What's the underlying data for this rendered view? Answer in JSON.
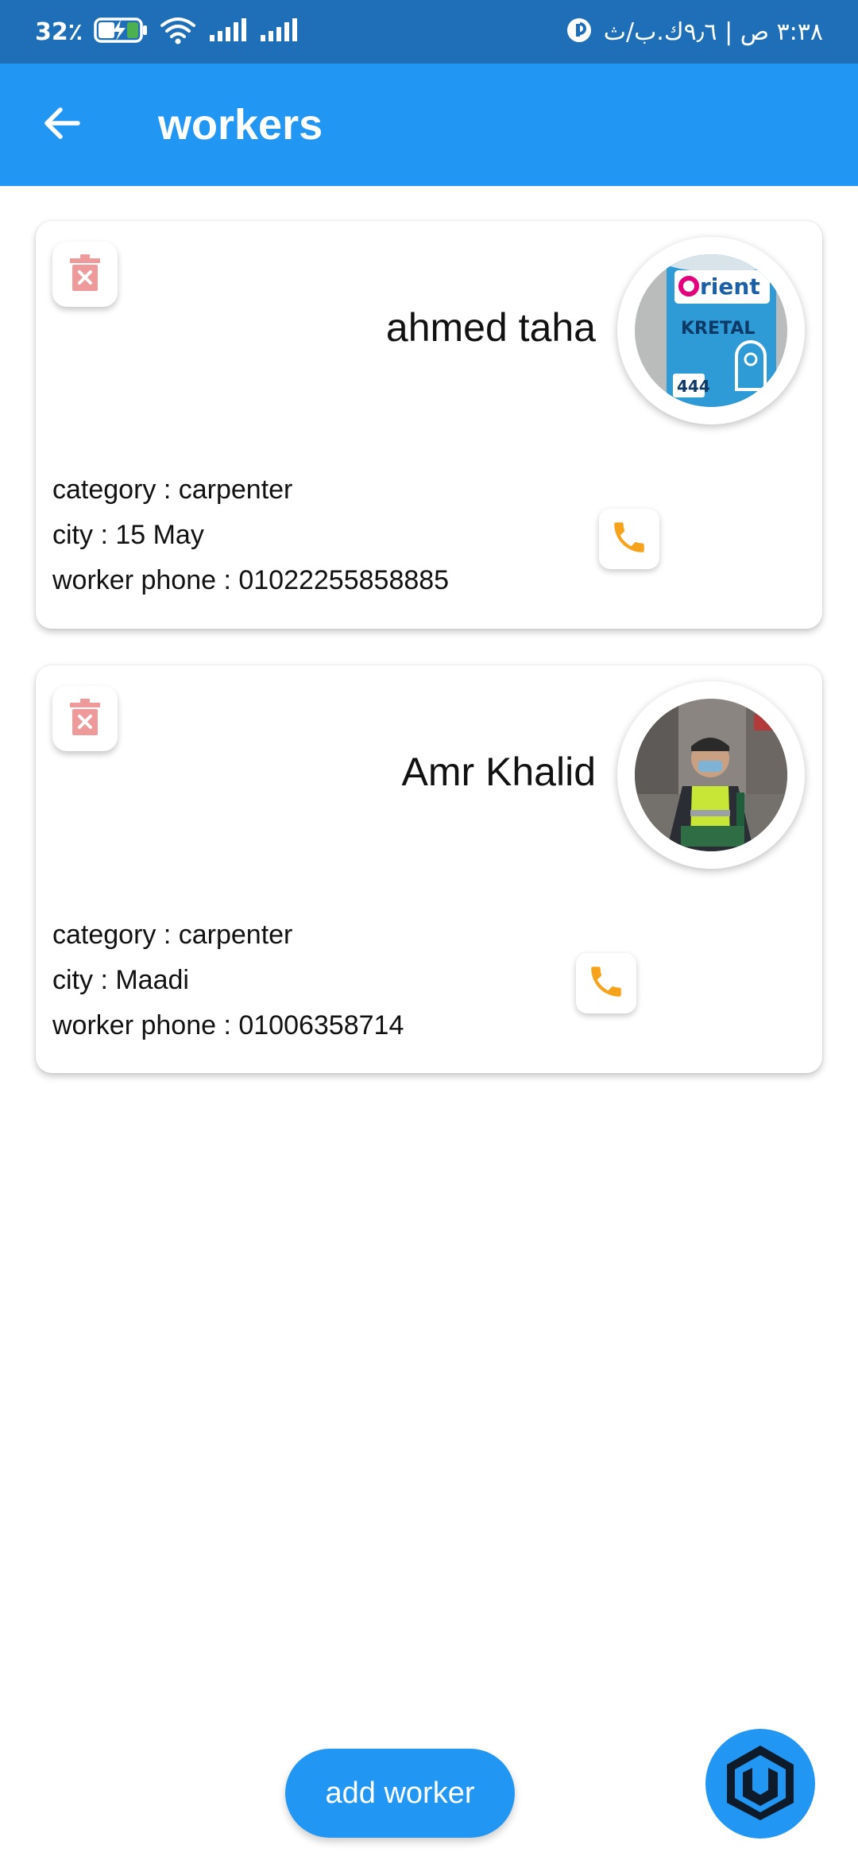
{
  "status_bar": {
    "battery_percent": "32٪",
    "time_text": "٣:٣٨ ص | ٩٫٦ك.ب/ث",
    "icons": [
      "battery-charging-icon",
      "wifi-icon",
      "signal-icon",
      "signal-icon",
      "vpn-icon"
    ]
  },
  "app_bar": {
    "title": "workers",
    "back_icon": "arrow-back-icon"
  },
  "workers": [
    {
      "name": "ahmed taha",
      "avatar": "paint-can-photo",
      "category": "category : carpenter",
      "city": "city : 15 May",
      "phone": "worker phone : 01022255858885"
    },
    {
      "name": "Amr Khalid",
      "avatar": "street-worker-photo",
      "category": "category : carpenter",
      "city": "city : Maadi",
      "phone": "worker phone : 01006358714"
    }
  ],
  "actions": {
    "add_worker_label": "add worker",
    "delete_icon": "trash-icon",
    "call_icon": "phone-icon",
    "fab_icon": "app-logo-icon"
  },
  "colors": {
    "primary": "#2196f3",
    "status_bar": "#1e6fb8",
    "delete": "#ef9a9a",
    "call": "#f7a21b"
  }
}
